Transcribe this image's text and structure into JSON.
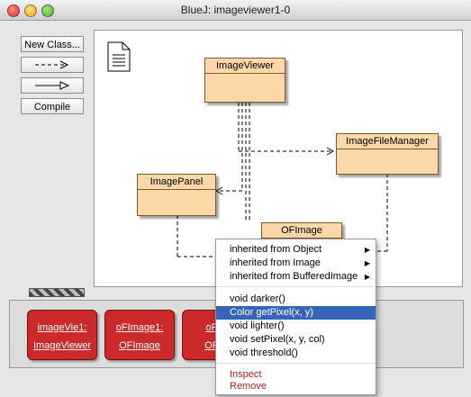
{
  "window": {
    "title": "BlueJ:  imageviewer1-0"
  },
  "toolbar": {
    "new_class_label": "New Class...",
    "dependency_arrow": "dashed-arrow-icon",
    "inheritance_arrow": "hollow-arrow-icon",
    "compile_label": "Compile"
  },
  "diagram": {
    "readme": "document-icon",
    "classes": {
      "image_viewer": "ImageViewer",
      "image_file_manager": "ImageFileManager",
      "image_panel": "ImagePanel",
      "of_image": "OFImage"
    }
  },
  "object_bench": {
    "objects": [
      {
        "line1": "imageVie1:",
        "line2": "ImageViewer"
      },
      {
        "line1": "oFImage1:",
        "line2": "OFImage"
      },
      {
        "line1": "oFIm",
        "line2": "OFIm"
      }
    ]
  },
  "context_menu": {
    "inherited": [
      "inherited from Object",
      "inherited from Image",
      "inherited from BufferedImage"
    ],
    "methods": [
      "void darker()",
      "Color getPixel(x, y)",
      "void lighter()",
      "void setPixel(x, y, col)",
      "void threshold()"
    ],
    "selected_method": "Color getPixel(x, y)",
    "actions": [
      "Inspect",
      "Remove"
    ]
  }
}
